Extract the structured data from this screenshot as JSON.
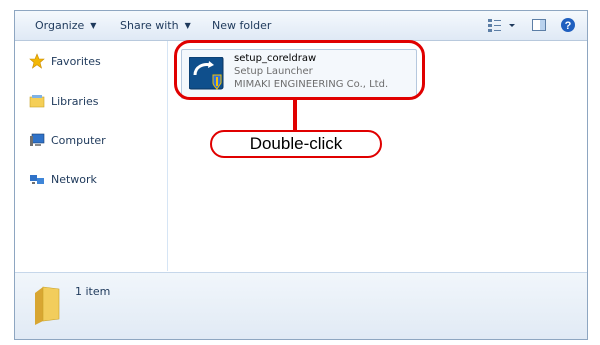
{
  "toolbar": {
    "organize_label": "Organize",
    "share_label": "Share with",
    "new_folder_label": "New folder"
  },
  "nav": {
    "items": [
      {
        "label": "Favorites",
        "icon": "star-icon"
      },
      {
        "label": "Libraries",
        "icon": "libraries-icon"
      },
      {
        "label": "Computer",
        "icon": "computer-icon"
      },
      {
        "label": "Network",
        "icon": "network-icon"
      }
    ]
  },
  "file": {
    "name": "setup_coreldraw",
    "type": "Setup Launcher",
    "company": "MIMAKI ENGINEERING Co., Ltd.",
    "icon": "setup-launcher-icon"
  },
  "status": {
    "count": "1 item"
  },
  "annotation": {
    "label": "Double-click",
    "color": "#e00000"
  }
}
